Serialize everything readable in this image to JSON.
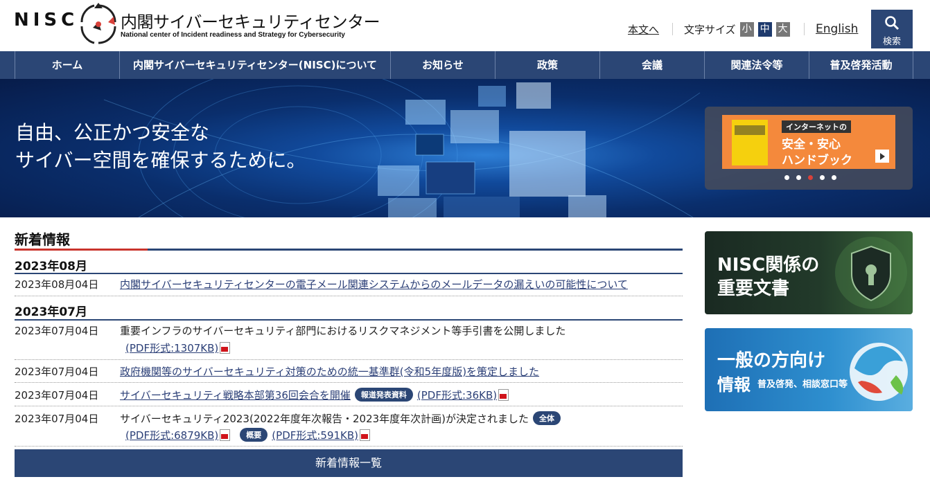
{
  "header": {
    "logo_text": "NISC",
    "site_title": "内閣サイバーセキュリティセンター",
    "site_subtitle": "National center of Incident readiness and Strategy for Cybersecurity",
    "skip_link": "本文へ",
    "font_size_label": "文字サイズ",
    "font_small": "小",
    "font_medium": "中",
    "font_large": "大",
    "english_link": "English",
    "search_label": "検索"
  },
  "nav": {
    "items": [
      "ホーム",
      "内閣サイバーセキュリティセンター(NISC)について",
      "お知らせ",
      "政策",
      "会議",
      "関連法令等",
      "普及啓発活動"
    ]
  },
  "hero": {
    "tagline_line1": "自由、公正かつ安全な",
    "tagline_line2": "サイバー空間を確保するために。",
    "banner": {
      "tag": "インターネットの",
      "line1": "安全・安心",
      "line2": "ハンドブック"
    }
  },
  "news": {
    "heading": "新着情報",
    "groups": [
      {
        "month": "2023年08月",
        "items": [
          {
            "date": "2023年08月04日",
            "title": "内閣サイバーセキュリティセンターの電子メール関連システムからのメールデータの漏えいの可能性について"
          }
        ]
      },
      {
        "month": "2023年07月",
        "items": [
          {
            "date": "2023年07月04日",
            "title": "重要インフラのサイバーセキュリティ部門におけるリスクマネジメント等手引書を公開しました",
            "pdf": "(PDF形式:1307KB)"
          },
          {
            "date": "2023年07月04日",
            "title": "政府機関等のサイバーセキュリティ対策のための統一基準群(令和5年度版)を策定しました"
          },
          {
            "date": "2023年07月04日",
            "title": "サイバーセキュリティ戦略本部第36回会合を開催",
            "badge": "報道発表資料",
            "pdf": "(PDF形式:36KB)"
          },
          {
            "date": "2023年07月04日",
            "title": "サイバーセキュリティ2023(2022年度年次報告・2023年度年次計画)が決定されました",
            "badge": "全体",
            "pdf": "(PDF形式:6879KB)",
            "badge2": "概要",
            "pdf2": "(PDF形式:591KB)"
          }
        ]
      }
    ],
    "more_button": "新着情報一覧"
  },
  "side": {
    "banner1_line1": "NISC関係の",
    "banner1_line2": "重要文書",
    "banner2_line1": "一般の方向け",
    "banner2_line2": "情報",
    "banner2_sub": "普及啓発、相談窓口等"
  },
  "colors": {
    "navy": "#2b4675",
    "accent_red": "#c9342c",
    "banner_orange": "#f4893c"
  }
}
